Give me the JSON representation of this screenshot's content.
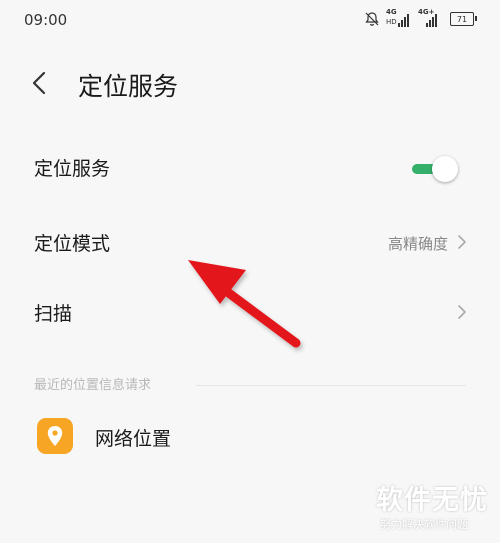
{
  "status_bar": {
    "time": "09:00",
    "sim1_network": "4G",
    "sim2_network": "4G+",
    "hd_label": "HD",
    "battery": "71",
    "icons": [
      "mute-bell-icon",
      "signal-icon",
      "signal-icon",
      "battery-icon"
    ]
  },
  "header": {
    "back_icon": "chevron-left-icon",
    "title": "定位服务"
  },
  "settings": {
    "location_service": {
      "label": "定位服务",
      "toggle_on": true
    },
    "location_mode": {
      "label": "定位模式",
      "value": "高精确度"
    },
    "scan": {
      "label": "扫描"
    }
  },
  "recent_requests": {
    "header": "最近的位置信息请求",
    "apps": [
      {
        "label": "网络位置",
        "icon": "location-pin-icon"
      }
    ]
  },
  "watermark": {
    "main": "软件无忧",
    "sub": "努力解决软件问题"
  },
  "colors": {
    "toggle_accent": "#35b06a",
    "app_icon_bg": "#f6a524",
    "arrow": "#e3161b"
  }
}
